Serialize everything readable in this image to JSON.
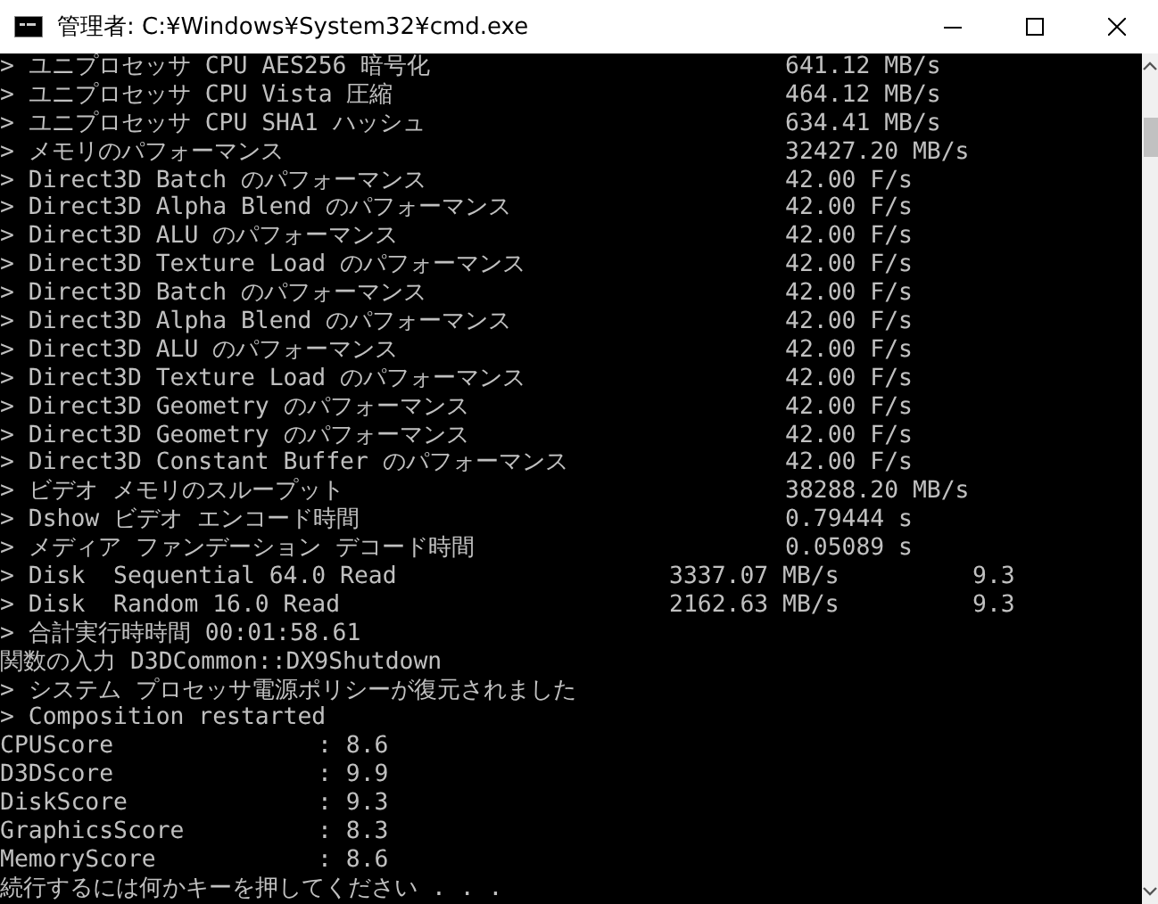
{
  "window": {
    "title": "管理者: C:¥Windows¥System32¥cmd.exe"
  },
  "lines": [
    {
      "kind": "result",
      "label": "> ユニプロセッサ CPU AES256 暗号化",
      "value": "641.12 MB/s"
    },
    {
      "kind": "result",
      "label": "> ユニプロセッサ CPU Vista 圧縮",
      "value": "464.12 MB/s"
    },
    {
      "kind": "result",
      "label": "> ユニプロセッサ CPU SHA1 ハッシュ",
      "value": "634.41 MB/s"
    },
    {
      "kind": "result",
      "label": "> メモリのパフォーマンス",
      "value": "32427.20 MB/s"
    },
    {
      "kind": "result",
      "label": "> Direct3D Batch のパフォーマンス",
      "value": "42.00 F/s"
    },
    {
      "kind": "result",
      "label": "> Direct3D Alpha Blend のパフォーマンス",
      "value": "42.00 F/s"
    },
    {
      "kind": "result",
      "label": "> Direct3D ALU のパフォーマンス",
      "value": "42.00 F/s"
    },
    {
      "kind": "result",
      "label": "> Direct3D Texture Load のパフォーマンス",
      "value": "42.00 F/s"
    },
    {
      "kind": "result",
      "label": "> Direct3D Batch のパフォーマンス",
      "value": "42.00 F/s"
    },
    {
      "kind": "result",
      "label": "> Direct3D Alpha Blend のパフォーマンス",
      "value": "42.00 F/s"
    },
    {
      "kind": "result",
      "label": "> Direct3D ALU のパフォーマンス",
      "value": "42.00 F/s"
    },
    {
      "kind": "result",
      "label": "> Direct3D Texture Load のパフォーマンス",
      "value": "42.00 F/s"
    },
    {
      "kind": "result",
      "label": "> Direct3D Geometry のパフォーマンス",
      "value": "42.00 F/s"
    },
    {
      "kind": "result",
      "label": "> Direct3D Geometry のパフォーマンス",
      "value": "42.00 F/s"
    },
    {
      "kind": "result",
      "label": "> Direct3D Constant Buffer のパフォーマンス",
      "value": "42.00 F/s"
    },
    {
      "kind": "result",
      "label": "> ビデオ メモリのスループット",
      "value": "38288.20 MB/s"
    },
    {
      "kind": "result",
      "label": "> Dshow ビデオ エンコード時間",
      "value": "0.79444 s"
    },
    {
      "kind": "result",
      "label": "> メディア ファンデーション デコード時間",
      "value": "0.05089 s"
    },
    {
      "kind": "disk",
      "label": "> Disk  Sequential 64.0 Read",
      "value": "3337.07 MB/s",
      "score": "9.3"
    },
    {
      "kind": "disk",
      "label": "> Disk  Random 16.0 Read",
      "value": "2162.63 MB/s",
      "score": "9.3"
    },
    {
      "kind": "text",
      "label": "> 合計実行時時間 00:01:58.61"
    },
    {
      "kind": "text",
      "label": "関数の入力 D3DCommon::DX9Shutdown"
    },
    {
      "kind": "text",
      "label": "> システム プロセッサ電源ポリシーが復元されました"
    },
    {
      "kind": "text",
      "label": "> Composition restarted"
    },
    {
      "kind": "score",
      "label": "CPUScore",
      "value": ": 8.6"
    },
    {
      "kind": "score",
      "label": "D3DScore",
      "value": ": 9.9"
    },
    {
      "kind": "score",
      "label": "DiskScore",
      "value": ": 9.3"
    },
    {
      "kind": "score",
      "label": "GraphicsScore",
      "value": ": 8.3"
    },
    {
      "kind": "score",
      "label": "MemoryScore",
      "value": ": 8.6"
    },
    {
      "kind": "text",
      "label": "続行するには何かキーを押してください . . ."
    }
  ]
}
